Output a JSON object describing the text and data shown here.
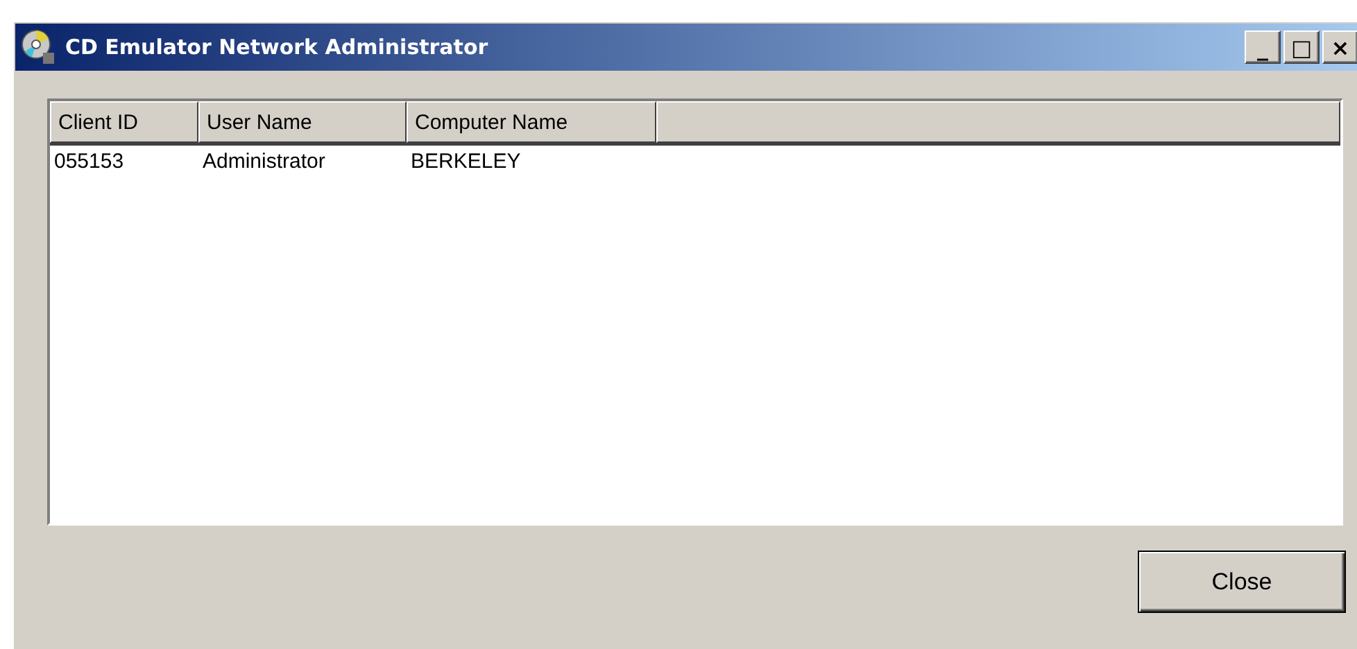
{
  "window": {
    "title": "CD Emulator Network Administrator",
    "controls": [
      "_",
      "□",
      "×"
    ]
  },
  "table": {
    "columns": [
      "Client ID",
      "User Name",
      "Computer Name"
    ],
    "rows": [
      {
        "cells": [
          "055153",
          "Administrator",
          "BERKELEY"
        ],
        "selected": false
      }
    ]
  },
  "buttons": [
    "Close"
  ]
}
